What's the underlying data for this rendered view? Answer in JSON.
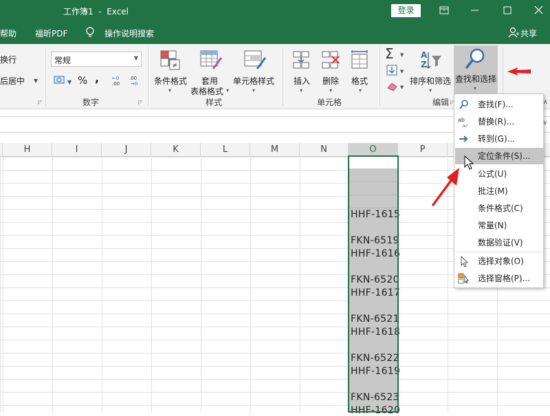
{
  "window": {
    "title": "工作簿1  -  Excel",
    "login_label": "登录"
  },
  "menubar": {
    "items": [
      "帮助",
      "福昕PDF",
      "操作说明搜索"
    ],
    "share_label": "共享"
  },
  "ribbon": {
    "align": {
      "wrap_label": "换行",
      "merge_label": "后居中"
    },
    "number": {
      "format_value": "常规",
      "group_label": "数字",
      "percent_symbol": "%",
      "comma_symbol": ","
    },
    "styles": {
      "conditional_label": "条件格式",
      "table_label_1": "套用",
      "table_label_2": "表格格式",
      "cell_style_label": "单元格样式",
      "group_label": "样式"
    },
    "cells": {
      "insert_label": "插入",
      "delete_label": "删除",
      "format_label": "格式",
      "group_label": "单元格"
    },
    "editing": {
      "sort_label": "排序和筛选",
      "find_label": "查找和选择",
      "group_label": "编辑"
    }
  },
  "columns": [
    "H",
    "I",
    "J",
    "K",
    "L",
    "M",
    "N",
    "O",
    "P"
  ],
  "column_o": {
    "cells": [
      "HHF-1615",
      "FKN-6519",
      "HHF-1616",
      "FKN-6520",
      "HHF-1617",
      "FKN-6521",
      "HHF-1618",
      "FKN-6522",
      "HHF-1619",
      "FKN-6523",
      "HHF-1620"
    ]
  },
  "dropdown": {
    "items": [
      {
        "label": "查找(F)...",
        "icon": "magnifier-icon"
      },
      {
        "label": "替换(R)...",
        "icon": "replace-abc-icon"
      },
      {
        "label": "转到(G)...",
        "icon": "arrow-right-icon"
      },
      {
        "label": "定位条件(S)...",
        "icon": "none"
      },
      {
        "label": "公式(U)",
        "icon": "none"
      },
      {
        "label": "批注(M)",
        "icon": "none"
      },
      {
        "label": "条件格式(C)",
        "icon": "none"
      },
      {
        "label": "常量(N)",
        "icon": "none"
      },
      {
        "label": "数据验证(V)",
        "icon": "none"
      },
      {
        "label": "选择对象(O)",
        "icon": "select-pointer-icon"
      },
      {
        "label": "选择窗格(P)...",
        "icon": "selection-pane-icon"
      }
    ],
    "highlighted": "定位条件(S)..."
  },
  "colors": {
    "excel_green": "#217346",
    "ribbon_bg": "#f3f3f3",
    "annotation_red": "#e02020",
    "selection_gray": "#c8c8c8"
  }
}
